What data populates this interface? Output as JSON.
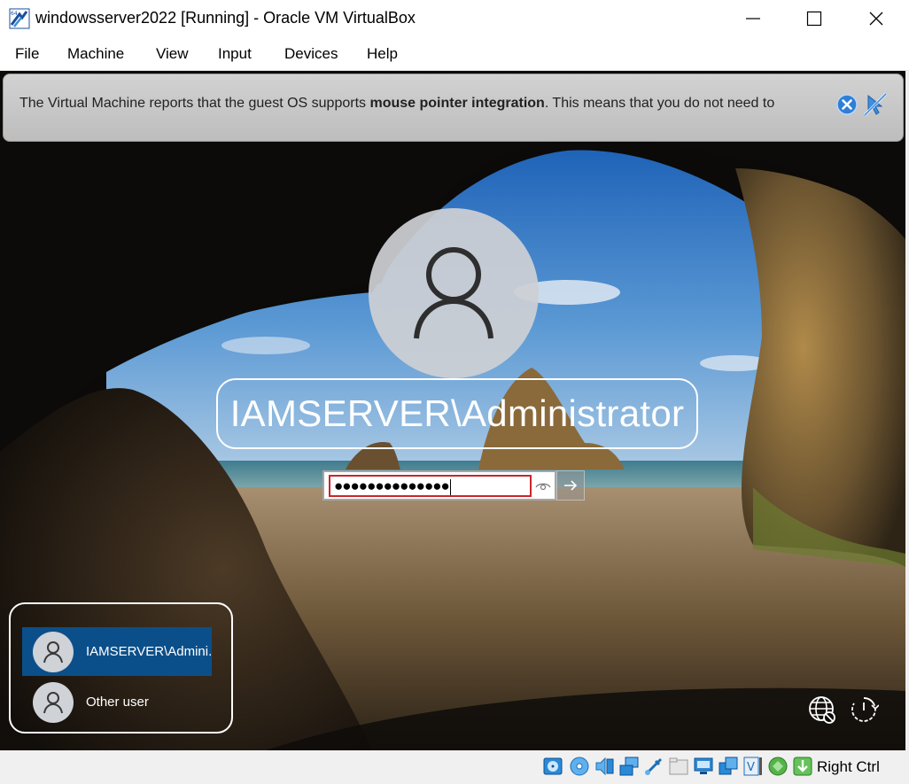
{
  "window": {
    "title": "windowsserver2022 [Running] - Oracle VM VirtualBox",
    "app_icon": "virtualbox-icon",
    "controls": [
      "minimize-icon",
      "maximize-icon",
      "close-icon"
    ]
  },
  "menu": {
    "items": [
      {
        "label": "File"
      },
      {
        "label": "Machine"
      },
      {
        "label": "View"
      },
      {
        "label": "Input"
      },
      {
        "label": "Devices"
      },
      {
        "label": "Help"
      }
    ]
  },
  "notification": {
    "text_before": "The Virtual Machine reports that the guest OS supports ",
    "text_bold": "mouse pointer integration",
    "text_after": ". This means that you do not need to",
    "close_icon": "close-circle-icon",
    "mute_icon": "mouse-integration-off-icon"
  },
  "login": {
    "user_name": "IAMSERVER\\Administrator",
    "password_mask": "●●●●●●●●●●●●●●",
    "reveal_icon": "eye-icon",
    "submit_icon": "arrow-right-icon",
    "user_list": [
      {
        "label": "IAMSERVER\\Admini...",
        "selected": true
      },
      {
        "label": "Other user",
        "selected": false
      }
    ],
    "network_icon": "network-globe-icon",
    "power_icon": "power-options-icon"
  },
  "statusbar": {
    "icons": [
      "hard-disk-icon",
      "optical-drive-icon",
      "audio-icon",
      "network-icon",
      "usb-icon",
      "shared-folders-icon",
      "display-icon",
      "recording-icon",
      "vrde-icon",
      "cpu-execution-icon",
      "mouse-integration-icon",
      "keyboard-capture-icon"
    ],
    "host_key": "Right Ctrl"
  },
  "colors": {
    "selected_user": "#0b4f8a",
    "password_focus": "#c8262b",
    "notification_bg": "#c8c8c8"
  }
}
